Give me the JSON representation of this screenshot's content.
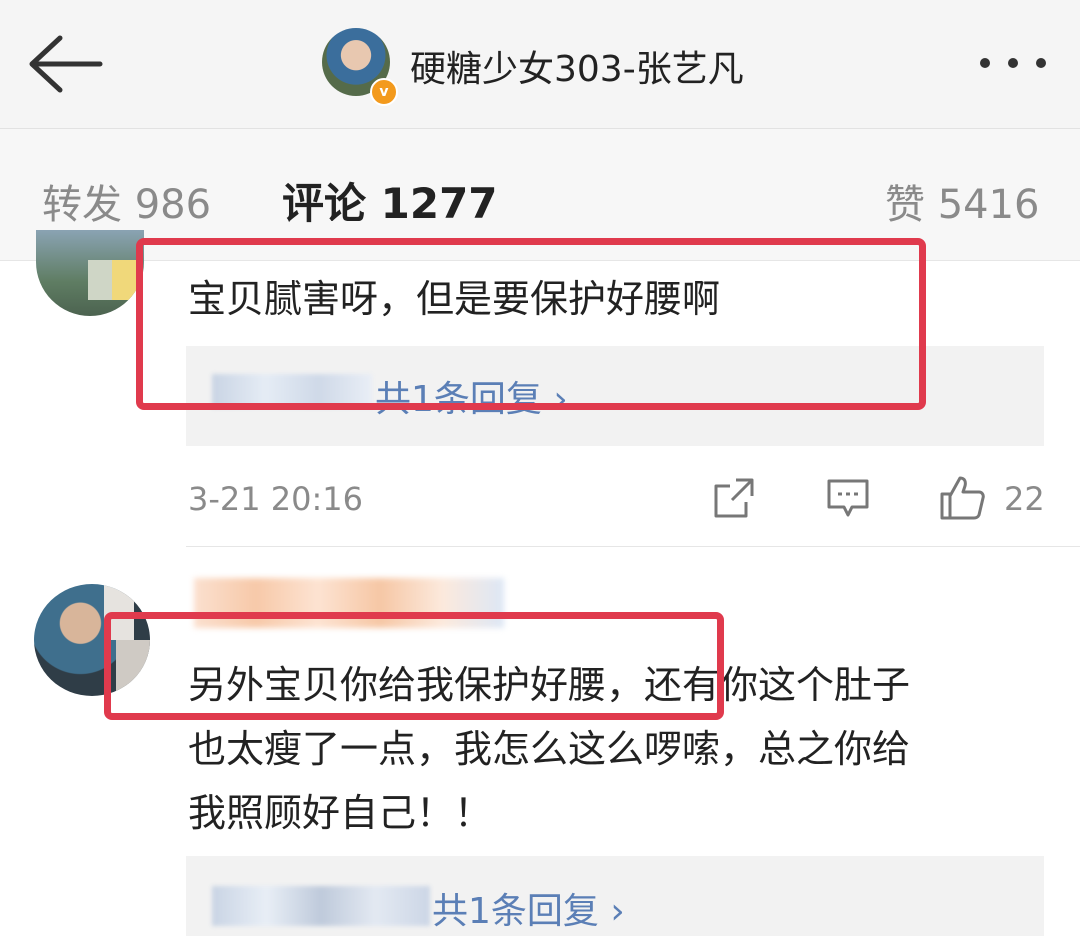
{
  "header": {
    "title": "硬糖少女303-张艺凡",
    "verified_mark": "v"
  },
  "tabs": {
    "repost": "转发 986",
    "comment": "评论 1277",
    "likes": "赞 5416"
  },
  "comments": [
    {
      "text": "宝贝腻害呀，但是要保护好腰啊",
      "reply_link": "共1条回复 ›",
      "time": "3-21 20:16",
      "like_count": "22"
    },
    {
      "lines": [
        "另外宝贝你给我保护好腰，还有你这个肚子",
        "也太瘦了一点，我怎么这么啰嗦，总之你给",
        "我照顾好自己！！"
      ],
      "reply_link": "共1条回复 ›"
    }
  ],
  "colors": {
    "highlight_box": "#e03a4d",
    "link": "#5b7fb6",
    "verified": "#f39a1d"
  },
  "icons": [
    "back-arrow-icon",
    "more-icon",
    "share-icon",
    "comment-icon",
    "thumbs-up-icon"
  ]
}
